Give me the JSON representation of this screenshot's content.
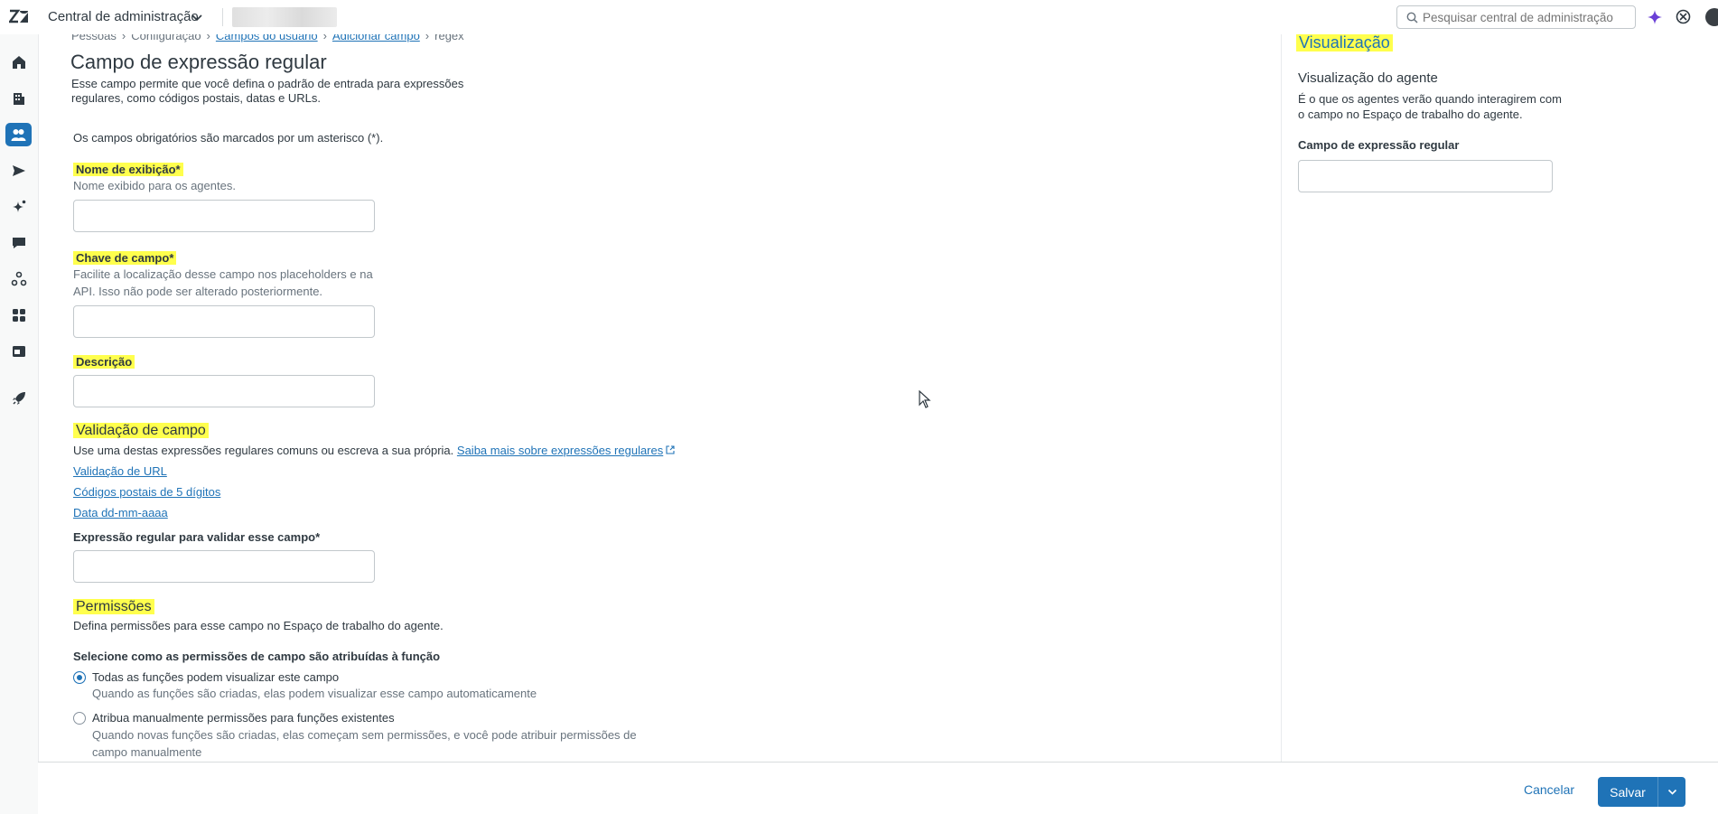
{
  "topbar": {
    "app_title": "Central de administração",
    "search_placeholder": "Pesquisar central de administração"
  },
  "breadcrumb": {
    "items": [
      "Pessoas",
      "Configuração",
      "Campos do usuário",
      "Adicionar campo",
      "regex"
    ]
  },
  "page": {
    "title": "Campo de expressão regular",
    "description": "Esse campo permite que você defina o padrão de entrada para expressões regulares, como códigos postais, datas e URLs.",
    "required_note": "Os campos obrigatórios são marcados por um asterisco (*)."
  },
  "form": {
    "display_name": {
      "label": "Nome de exibição*",
      "hint": "Nome exibido para os agentes.",
      "value": ""
    },
    "field_key": {
      "label": "Chave de campo*",
      "hint_line1": "Facilite a localização desse campo nos placeholders e na",
      "hint_line2": "API. Isso não pode ser alterado posteriormente.",
      "value": ""
    },
    "description": {
      "label": "Descrição",
      "value": ""
    },
    "validation": {
      "title": "Validação de campo",
      "text": "Use uma destas expressões regulares comuns ou escreva a sua própria.",
      "learn_more": "Saiba mais sobre expressões regulares",
      "presets": [
        "Validação de URL",
        "Códigos postais de 5 dígitos",
        "Data dd-mm-aaaa"
      ],
      "regex_label": "Expressão regular para validar esse campo*",
      "regex_value": ""
    },
    "permissions": {
      "title": "Permissões",
      "description": "Defina permissões para esse campo no Espaço de trabalho do agente.",
      "question": "Selecione como as permissões de campo são atribuídas à função",
      "options": [
        {
          "label": "Todas as funções podem visualizar este campo",
          "hint": "Quando as funções são criadas, elas podem visualizar esse campo automaticamente",
          "checked": true
        },
        {
          "label": "Atribua manualmente permissões para funções existentes",
          "hint": "Quando novas funções são criadas, elas começam sem permissões, e você pode atribuir permissões de campo manualmente",
          "checked": false
        }
      ]
    }
  },
  "preview": {
    "title": "Visualização",
    "subtitle": "Visualização do agente",
    "description": "É o que os agentes verão quando interagirem com o campo no Espaço de trabalho do agente.",
    "field_label": "Campo de expressão regular"
  },
  "footer": {
    "cancel_label": "Cancelar",
    "save_label": "Salvar"
  },
  "colors": {
    "accent": "#1f73b7",
    "highlight": "#ffff4d"
  },
  "icons": {
    "nav": [
      "home-icon",
      "building-icon",
      "people-icon",
      "send-icon",
      "sparkle-icon",
      "chat-icon",
      "objects-icon",
      "apps-icon",
      "workspace-icon",
      "rocket-icon"
    ]
  }
}
